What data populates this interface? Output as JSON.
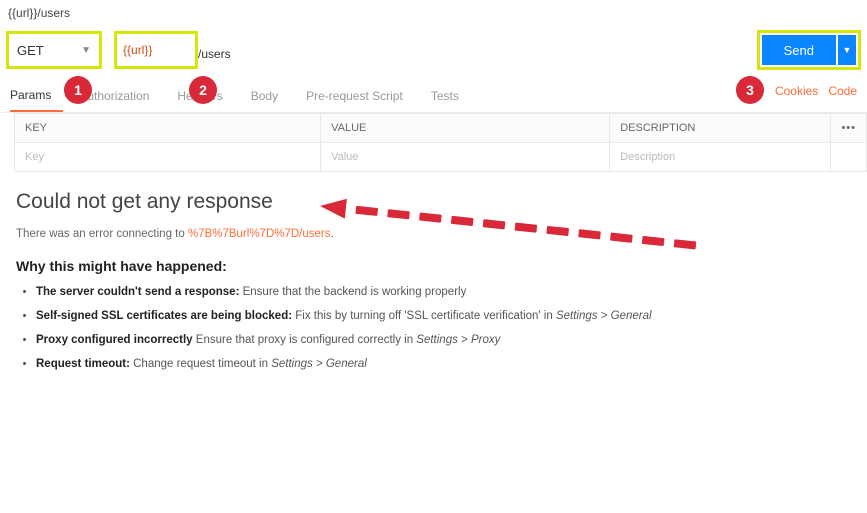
{
  "top_url": "{{url}}/users",
  "method": "GET",
  "url_var": "{{url}}",
  "url_rest": "/users",
  "send_label": "Send",
  "tabs": [
    "Params",
    "Authorization",
    "Headers",
    "Body",
    "Pre-request Script",
    "Tests"
  ],
  "right_links": [
    "Cookies",
    "Code"
  ],
  "cols": {
    "key": "KEY",
    "value": "VALUE",
    "desc": "DESCRIPTION"
  },
  "placeholders": {
    "key": "Key",
    "value": "Value",
    "desc": "Description"
  },
  "response": {
    "title": "Could not get any response",
    "err_prefix": "There was an error connecting to ",
    "err_url": "%7B%7Burl%7D%7D/users",
    "err_suffix": ".",
    "why_title": "Why this might have happened:",
    "reasons": [
      {
        "b": "The server couldn't send a response:",
        "t": " Ensure that the backend is working properly"
      },
      {
        "b": "Self-signed SSL certificates are being blocked:",
        "t": " Fix this by turning off 'SSL certificate verification' in ",
        "i": "Settings > General"
      },
      {
        "b": "Proxy configured incorrectly",
        "t": " Ensure that proxy is configured correctly in ",
        "i": "Settings > Proxy"
      },
      {
        "b": "Request timeout:",
        "t": " Change request timeout in ",
        "i": "Settings > General"
      }
    ]
  },
  "annotations": {
    "one": "1",
    "two": "2",
    "three": "3"
  }
}
